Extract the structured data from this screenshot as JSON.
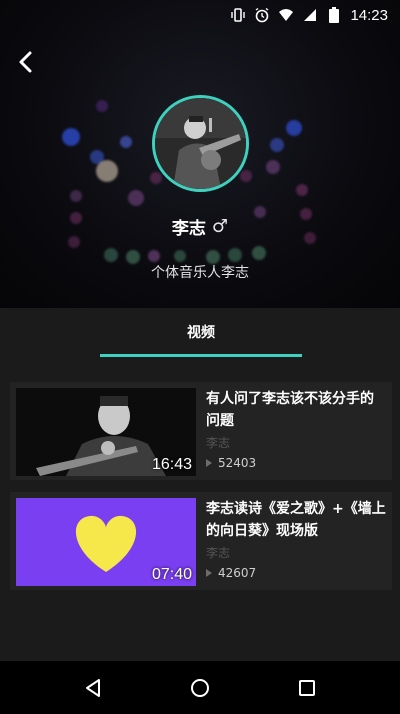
{
  "status_bar": {
    "time": "14:23",
    "icons": [
      "vibrate-icon",
      "alarm-icon",
      "wifi-icon",
      "signal-icon",
      "battery-icon"
    ]
  },
  "header": {
    "back_icon": "back-chevron-icon",
    "artist_name": "李志",
    "gender_symbol": "♂",
    "bio": "个体音乐人李志"
  },
  "tabs": [
    {
      "label": "视频",
      "active": true
    }
  ],
  "colors": {
    "accent": "#3fd1bf",
    "background": "#1b1b1b",
    "card": "#232323",
    "thumb_purple": "#7b3ff2",
    "heart_yellow": "#f6e84a"
  },
  "videos": [
    {
      "title": "有人问了李志该不该分手的问题",
      "author": "李志",
      "plays": "52403",
      "duration": "16:43"
    },
    {
      "title": "李志读诗《爱之歌》+《墙上的向日葵》现场版",
      "author": "李志",
      "plays": "42607",
      "duration": "07:40"
    }
  ],
  "nav_bar": {
    "icons": [
      "back-triangle-icon",
      "home-circle-icon",
      "recents-square-icon"
    ]
  }
}
